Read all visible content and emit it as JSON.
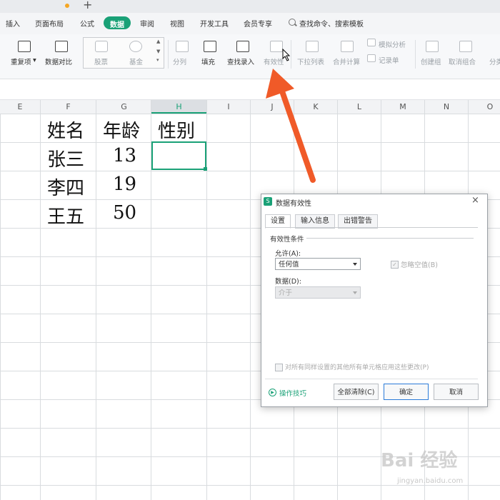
{
  "menu": {
    "items": [
      "插入",
      "页面布局",
      "公式",
      "数据",
      "审阅",
      "视图",
      "开发工具",
      "会员专享"
    ],
    "active": "数据",
    "search_label": "查找命令、搜索模板",
    "plus": "+"
  },
  "ribbon": {
    "remove_dup": "重复项",
    "compare": "数据对比",
    "stock": "股票",
    "fund": "基金",
    "split": "分列",
    "fill": "填充",
    "lookup": "查找录入",
    "validity": "有效性",
    "dropdown": "下拉列表",
    "consolidate": "合并计算",
    "whatif": "模拟分析",
    "form": "记录单",
    "group": "创建组",
    "ungroup": "取消组合",
    "subtotal": "分类"
  },
  "sheet": {
    "columns": [
      "E",
      "F",
      "G",
      "H",
      "I",
      "J",
      "K",
      "L",
      "M",
      "N",
      "O"
    ],
    "selected_column": "H",
    "headers": [
      "姓名",
      "年龄",
      "性别"
    ],
    "rows": [
      {
        "name": "张三",
        "age": "13"
      },
      {
        "name": "李四",
        "age": "19"
      },
      {
        "name": "王五",
        "age": "50"
      }
    ]
  },
  "dialog": {
    "title": "数据有效性",
    "close": "×",
    "tabs": [
      "设置",
      "输入信息",
      "出错警告"
    ],
    "active_tab": "设置",
    "group_label": "有效性条件",
    "allow_label": "允许(A):",
    "allow_value": "任何值",
    "ignore_blank": "忽略空值(B)",
    "data_label": "数据(D):",
    "data_value": "介于",
    "apply_all": "对所有同样设置的其他所有单元格应用这些更改(P)",
    "tips": "操作技巧",
    "btn_clear": "全部清除(C)",
    "btn_ok": "确定",
    "btn_cancel": "取消"
  },
  "watermark": {
    "main": "Bai 经验",
    "sub": "jingyan.baidu.com"
  },
  "colors": {
    "accent": "#1aa177",
    "arrow": "#f05a28",
    "ok_border": "#2b7bd8"
  }
}
